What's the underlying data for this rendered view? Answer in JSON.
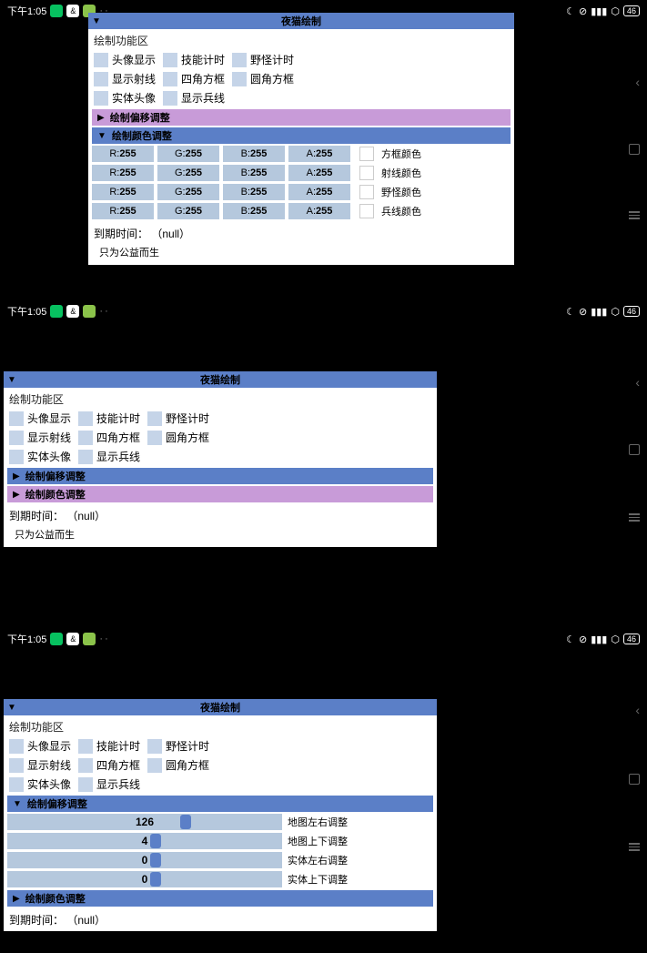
{
  "statusbar": {
    "time": "下午1:05",
    "battery": "46"
  },
  "panel": {
    "title": "夜猫绘制",
    "section_label": "绘制功能区",
    "checks": {
      "r1": {
        "c1": "头像显示",
        "c2": "技能计时",
        "c3": "野怪计时"
      },
      "r2": {
        "c1": "显示射线",
        "c2": "四角方框",
        "c3": "圆角方框"
      },
      "r3": {
        "c1": "实体头像",
        "c2": "显示兵线"
      }
    },
    "accordion": {
      "offset": "绘制偏移调整",
      "color": "绘制颜色调整"
    },
    "rgba": {
      "row1": {
        "r": "R:",
        "rv": "255",
        "g": "G:",
        "gv": "255",
        "b": "B:",
        "bv": "255",
        "a": "A:",
        "av": "255",
        "label": "方框颜色"
      },
      "row2": {
        "r": "R:",
        "rv": "255",
        "g": "G:",
        "gv": "255",
        "b": "B:",
        "bv": "255",
        "a": "A:",
        "av": "255",
        "label": "射线颜色"
      },
      "row3": {
        "r": "R:",
        "rv": "255",
        "g": "G:",
        "gv": "255",
        "b": "B:",
        "bv": "255",
        "a": "A:",
        "av": "255",
        "label": "野怪颜色"
      },
      "row4": {
        "r": "R:",
        "rv": "255",
        "g": "G:",
        "gv": "255",
        "b": "B:",
        "bv": "255",
        "a": "A:",
        "av": "255",
        "label": "兵线颜色"
      }
    },
    "sliders": {
      "s1": {
        "value": "126",
        "label": "地图左右调整",
        "thumb_pct": 63
      },
      "s2": {
        "value": "4",
        "label": "地图上下调整",
        "thumb_pct": 52
      },
      "s3": {
        "value": "0",
        "label": "实体左右调整",
        "thumb_pct": 52
      },
      "s4": {
        "value": "0",
        "label": "实体上下调整",
        "thumb_pct": 52
      }
    },
    "expiry_label": "到期时间：",
    "expiry_value": "（null）",
    "footer": "只为公益而生"
  }
}
